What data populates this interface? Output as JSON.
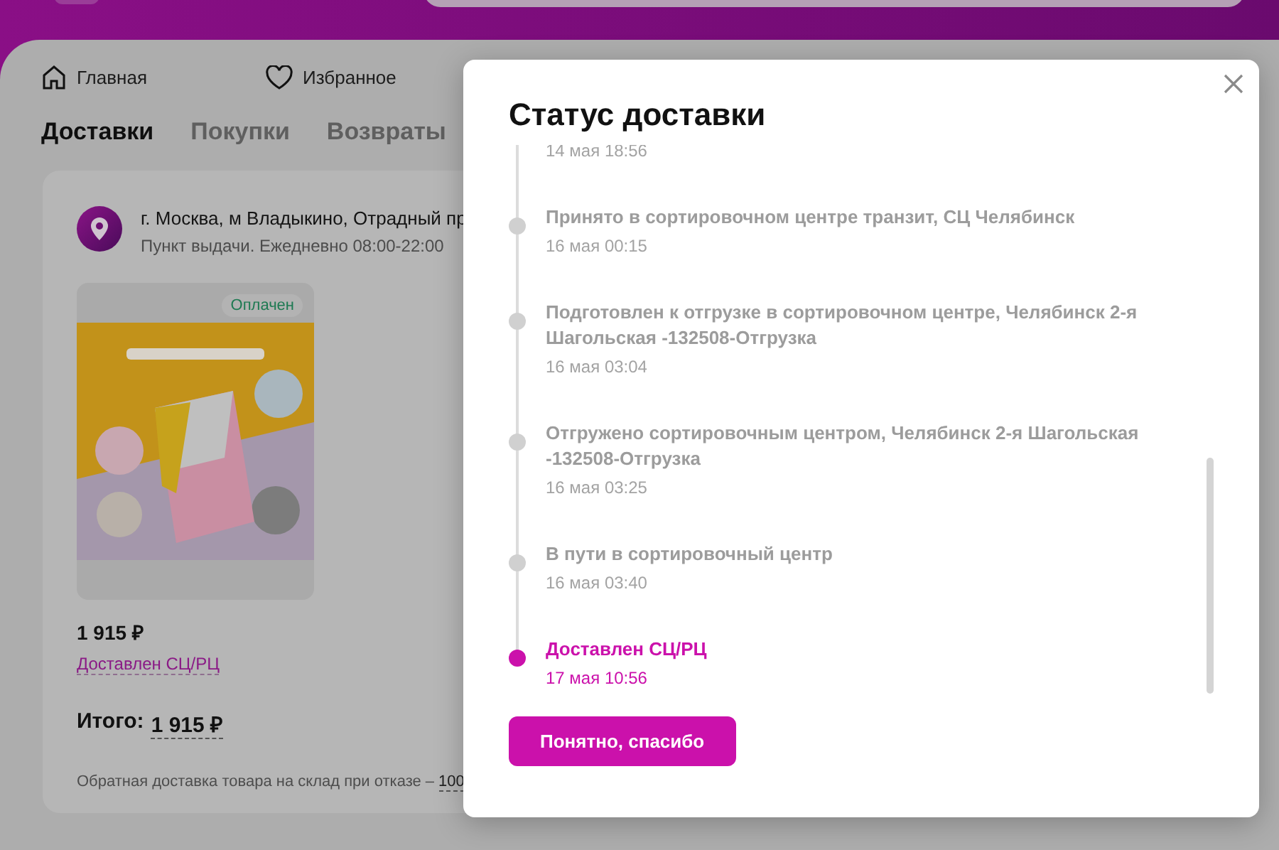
{
  "nav": [
    {
      "kind": "home",
      "label": "Главная"
    },
    {
      "kind": "favorites",
      "label": "Избранное"
    }
  ],
  "tabs": [
    {
      "label": "Доставки",
      "selected": true
    },
    {
      "label": "Покупки",
      "selected": false
    },
    {
      "label": "Возвраты",
      "selected": false
    }
  ],
  "order": {
    "address": "г. Москва, м Владыкино, Отрадный пр",
    "hours": "Пункт выдачи. Ежедневно 08:00-22:00",
    "item": {
      "badge": "Оплачен",
      "price": "1 915 ₽",
      "status": "Доставлен СЦ/РЦ"
    },
    "total_label": "Итого:",
    "total_value": "1 915 ₽",
    "return_note": "Обратная доставка товара на склад при отказе –",
    "return_link": "100"
  },
  "modal": {
    "title": "Статус доставки",
    "events": [
      {
        "date": "14 мая 18:56",
        "current": false
      },
      {
        "title": "Принято в сортировочном центре транзит, СЦ Челябинск",
        "date": "16 мая 00:15",
        "current": false
      },
      {
        "title": "Подготовлен к отгрузке в сортировочном центре, Челябинск 2-я Шагольская -132508-Отгрузка",
        "date": "16 мая 03:04",
        "current": false
      },
      {
        "title": "Отгружено сортировочным центром, Челябинск 2-я Шагольская -132508-Отгрузка",
        "date": "16 мая 03:25",
        "current": false
      },
      {
        "title": "В пути в сортировочный центр",
        "date": "16 мая 03:40",
        "current": false
      },
      {
        "title": "Доставлен СЦ/РЦ",
        "date": "17 мая 10:56",
        "current": true
      }
    ],
    "button": "Понятно, спасибо"
  }
}
